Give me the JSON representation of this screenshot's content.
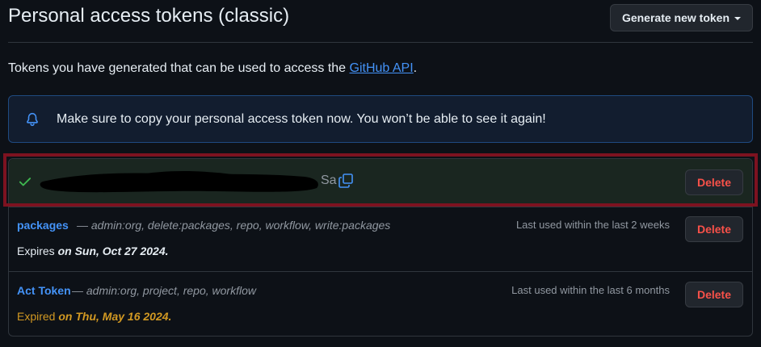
{
  "header": {
    "title": "Personal access tokens (classic)",
    "generate_button": "Generate new token"
  },
  "intro": {
    "text_before": "Tokens you have generated that can be used to access the ",
    "link": "GitHub API",
    "text_after": "."
  },
  "flash": {
    "icon": "bell-icon",
    "message": "Make sure to copy your personal access token now. You won’t be able to see it again!"
  },
  "new_token": {
    "icon": "check-icon",
    "visible_suffix": "Sa",
    "copy_icon": "copy-icon",
    "delete_label": "Delete"
  },
  "tokens": [
    {
      "name": "packages",
      "scopes": "— admin:org, delete:packages, repo, workflow, write:packages",
      "last_used": "Last used within the last 2 weeks",
      "expiry_prefix": "Expires ",
      "expiry_date": "on Sun, Oct 27 2024.",
      "expired": false,
      "delete_label": "Delete"
    },
    {
      "name": "Act Token",
      "scopes": "— admin:org, project, repo, workflow",
      "last_used": "Last used within the last 6 months",
      "expiry_prefix": "Expired ",
      "expiry_date": "on Thu, May 16 2024.",
      "expired": true,
      "delete_label": "Delete"
    }
  ],
  "colors": {
    "background": "#0d1117",
    "link": "#4493f8",
    "danger": "#f85149",
    "success": "#3fb950",
    "warning": "#d29922",
    "highlight_border": "#7d1220"
  }
}
